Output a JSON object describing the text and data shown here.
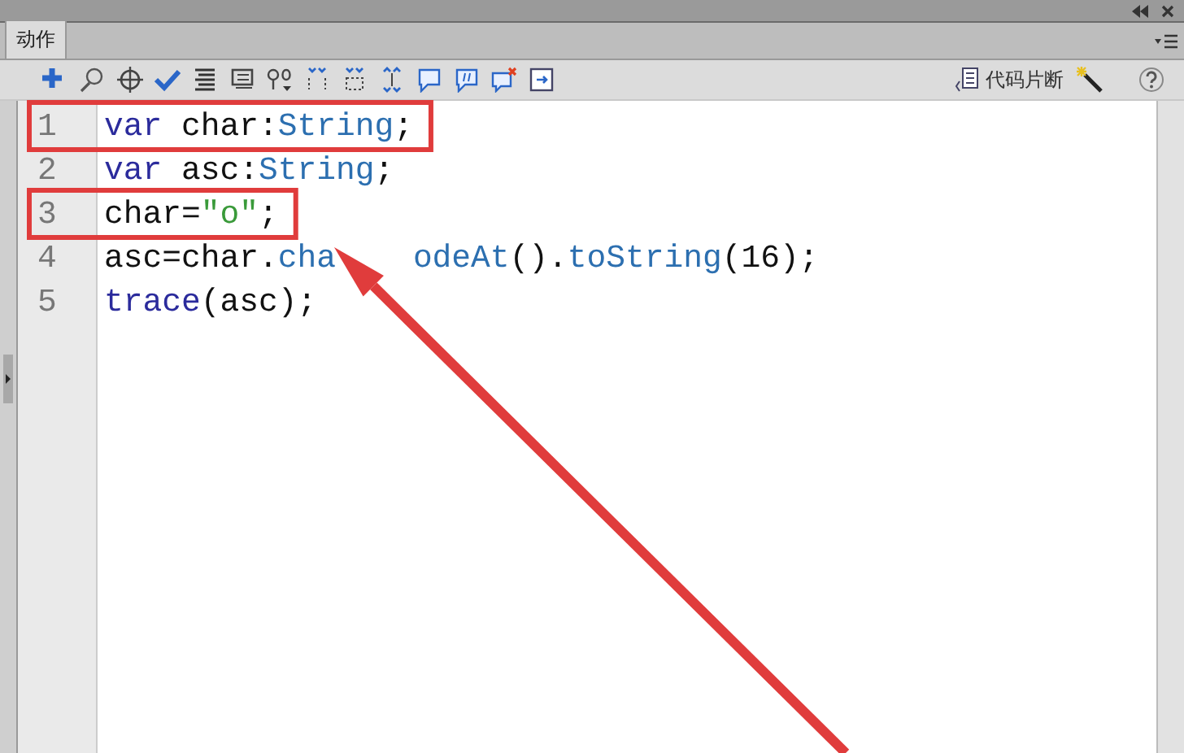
{
  "panel": {
    "tab": {
      "label": "动作",
      "selected": true
    }
  },
  "toolbar": {
    "snippets_label": "代码片断"
  },
  "code": {
    "lines": [
      {
        "number": "1",
        "boxed": true,
        "tokens": [
          {
            "kind": "keyword",
            "text": "var"
          },
          {
            "kind": "plain",
            "text": " char:"
          },
          {
            "kind": "type",
            "text": "String"
          },
          {
            "kind": "plain",
            "text": ";"
          }
        ]
      },
      {
        "number": "2",
        "boxed": false,
        "tokens": [
          {
            "kind": "keyword",
            "text": "var"
          },
          {
            "kind": "plain",
            "text": " asc:"
          },
          {
            "kind": "type",
            "text": "String"
          },
          {
            "kind": "plain",
            "text": ";"
          }
        ]
      },
      {
        "number": "3",
        "boxed": true,
        "tokens": [
          {
            "kind": "plain",
            "text": "char="
          },
          {
            "kind": "string",
            "text": "\"o\""
          },
          {
            "kind": "plain",
            "text": ";"
          }
        ]
      },
      {
        "number": "4",
        "boxed": false,
        "tokens": [
          {
            "kind": "plain",
            "text": "asc=char."
          },
          {
            "kind": "type",
            "text": "cha"
          },
          {
            "kind": "covered"
          },
          {
            "kind": "type",
            "text": "odeAt"
          },
          {
            "kind": "plain",
            "text": "()."
          },
          {
            "kind": "type",
            "text": "toString"
          },
          {
            "kind": "plain",
            "text": "(16);"
          }
        ]
      },
      {
        "number": "5",
        "boxed": false,
        "tokens": [
          {
            "kind": "keyword",
            "text": "trace"
          },
          {
            "kind": "plain",
            "text": "(asc);"
          }
        ]
      }
    ]
  },
  "annotation_arrow": true
}
